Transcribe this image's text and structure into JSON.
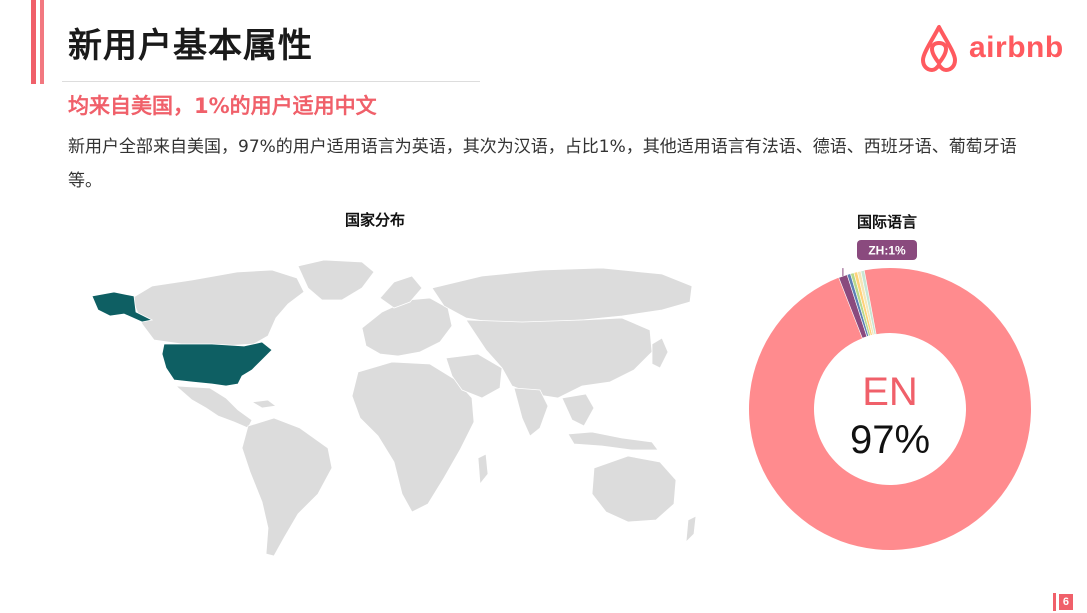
{
  "slide": {
    "title": "新用户基本属性",
    "subtitle": "均来自美国，1%的用户适用中文",
    "body": "新用户全部来自美国，97%的用户适用语言为英语，其次为汉语，占比1%，其他适用语言有法语、德语、西班牙语、葡萄牙语等。",
    "page_number": "6",
    "logo_text": "airbnb",
    "colors": {
      "accent": "#f0606a",
      "brand": "#ff5a5f",
      "map_highlight": "#0e5f63",
      "map_land": "#dcdcdc"
    }
  },
  "map_panel": {
    "title": "国家分布",
    "highlighted_country": "United States"
  },
  "chart_data": {
    "type": "pie",
    "style": "donut",
    "title": "国际语言",
    "center_label": "EN",
    "center_value": "97%",
    "callout": "ZH:1%",
    "slices": [
      {
        "label": "EN",
        "value": 97,
        "color": "#ff8b8e"
      },
      {
        "label": "ZH",
        "value": 1,
        "color": "#8a4a7e"
      },
      {
        "label": "",
        "value": 0.4,
        "color": "#5b7fb5"
      },
      {
        "label": "",
        "value": 0.4,
        "color": "#b8d98c"
      },
      {
        "label": "",
        "value": 0.4,
        "color": "#ffd27a"
      },
      {
        "label": "",
        "value": 0.4,
        "color": "#f4e7b8"
      },
      {
        "label": "",
        "value": 0.4,
        "color": "#c9e6d4"
      }
    ]
  }
}
